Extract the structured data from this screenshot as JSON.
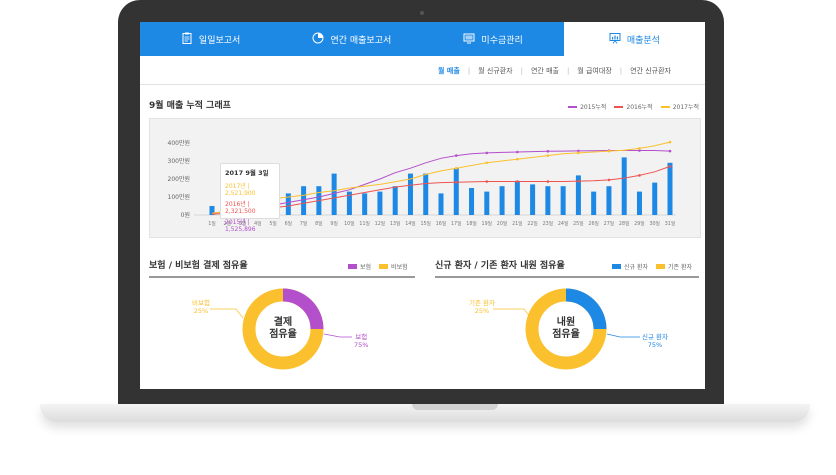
{
  "tabs": [
    {
      "label": "일일보고서",
      "icon": "clipboard-icon",
      "active": false
    },
    {
      "label": "연간 매출보고서",
      "icon": "pie-chart-icon",
      "active": false
    },
    {
      "label": "미수금관리",
      "icon": "monitor-icon",
      "active": false
    },
    {
      "label": "매출분석",
      "icon": "presentation-chart-icon",
      "active": true
    }
  ],
  "subnav": [
    "월 매출",
    "월 신규환자",
    "연간 매출",
    "월 급여대장",
    "연간 신규환자"
  ],
  "monthly": {
    "title": "9월 매출 누적 그래프",
    "tooltip": {
      "title": "2017 9월 3일",
      "rows": [
        {
          "label": "2017년",
          "value": "2,521,900"
        },
        {
          "label": "2016년",
          "value": "2,321,500"
        },
        {
          "label": "2015년",
          "value": "1,525,896"
        }
      ]
    }
  },
  "chart_data": {
    "type": "bar",
    "title": "9월 매출 누적 그래프",
    "categories": [
      "1일",
      "2일",
      "3일",
      "4일",
      "5일",
      "6일",
      "7일",
      "8일",
      "9일",
      "10일",
      "11일",
      "12일",
      "13일",
      "14일",
      "15일",
      "16일",
      "17일",
      "18일",
      "19일",
      "20일",
      "21일",
      "22일",
      "23일",
      "24일",
      "25일",
      "26일",
      "27일",
      "28일",
      "29일",
      "30일",
      "31일"
    ],
    "yticks": [
      "0원",
      "100만원",
      "200만원",
      "300만원",
      "400만원"
    ],
    "ylim": [
      0,
      400
    ],
    "bars": {
      "color": "#1e88e5",
      "values": [
        50,
        0,
        0,
        0,
        0,
        120,
        160,
        160,
        230,
        130,
        120,
        130,
        160,
        230,
        230,
        120,
        260,
        150,
        130,
        160,
        190,
        170,
        160,
        160,
        220,
        130,
        160,
        320,
        130,
        180,
        290
      ]
    },
    "series": [
      {
        "name": "2015누적",
        "color": "#b44fcb",
        "values": [
          10,
          20,
          30,
          40,
          55,
          70,
          85,
          100,
          120,
          140,
          170,
          200,
          235,
          260,
          290,
          315,
          330,
          340,
          345,
          348,
          350,
          352,
          354,
          355,
          356,
          357,
          358,
          358,
          358,
          358,
          355
        ]
      },
      {
        "name": "2016누적",
        "color": "#ef5350",
        "values": [
          5,
          10,
          20,
          30,
          40,
          50,
          65,
          80,
          95,
          110,
          125,
          140,
          155,
          165,
          175,
          180,
          182,
          184,
          186,
          186,
          186,
          186,
          186,
          186,
          188,
          190,
          195,
          205,
          220,
          240,
          270
        ]
      },
      {
        "name": "2017누적",
        "color": "#fbc02d",
        "values": [
          10,
          20,
          40,
          70,
          90,
          100,
          110,
          125,
          135,
          150,
          160,
          170,
          185,
          200,
          225,
          245,
          260,
          275,
          290,
          300,
          310,
          320,
          330,
          340,
          345,
          350,
          355,
          360,
          370,
          385,
          405
        ]
      }
    ],
    "legend_position": "top-right",
    "grid": false
  },
  "payment": {
    "title": "보험 / 비보험 결제 점유율",
    "legend": [
      {
        "label": "보험",
        "color": "#b44fcb"
      },
      {
        "label": "비보험",
        "color": "#fbc02d"
      }
    ],
    "center": [
      "결제",
      "점유율"
    ],
    "segments": [
      {
        "label": "보험",
        "pct": "75%",
        "value": 75,
        "color": "#fbc02d"
      },
      {
        "label": "비보험",
        "pct": "25%",
        "value": 25,
        "color": "#b44fcb"
      }
    ]
  },
  "patients": {
    "title": "신규 환자 / 기존 환자 내원 점유율",
    "legend": [
      {
        "label": "신규 환자",
        "color": "#1e88e5"
      },
      {
        "label": "기존 환자",
        "color": "#fbc02d"
      }
    ],
    "center": [
      "내원",
      "점유율"
    ],
    "segments": [
      {
        "label": "신규 환자",
        "pct": "75%",
        "value": 75,
        "color": "#fbc02d"
      },
      {
        "label": "기존 환자",
        "pct": "25%",
        "value": 25,
        "color": "#1e88e5"
      }
    ]
  }
}
